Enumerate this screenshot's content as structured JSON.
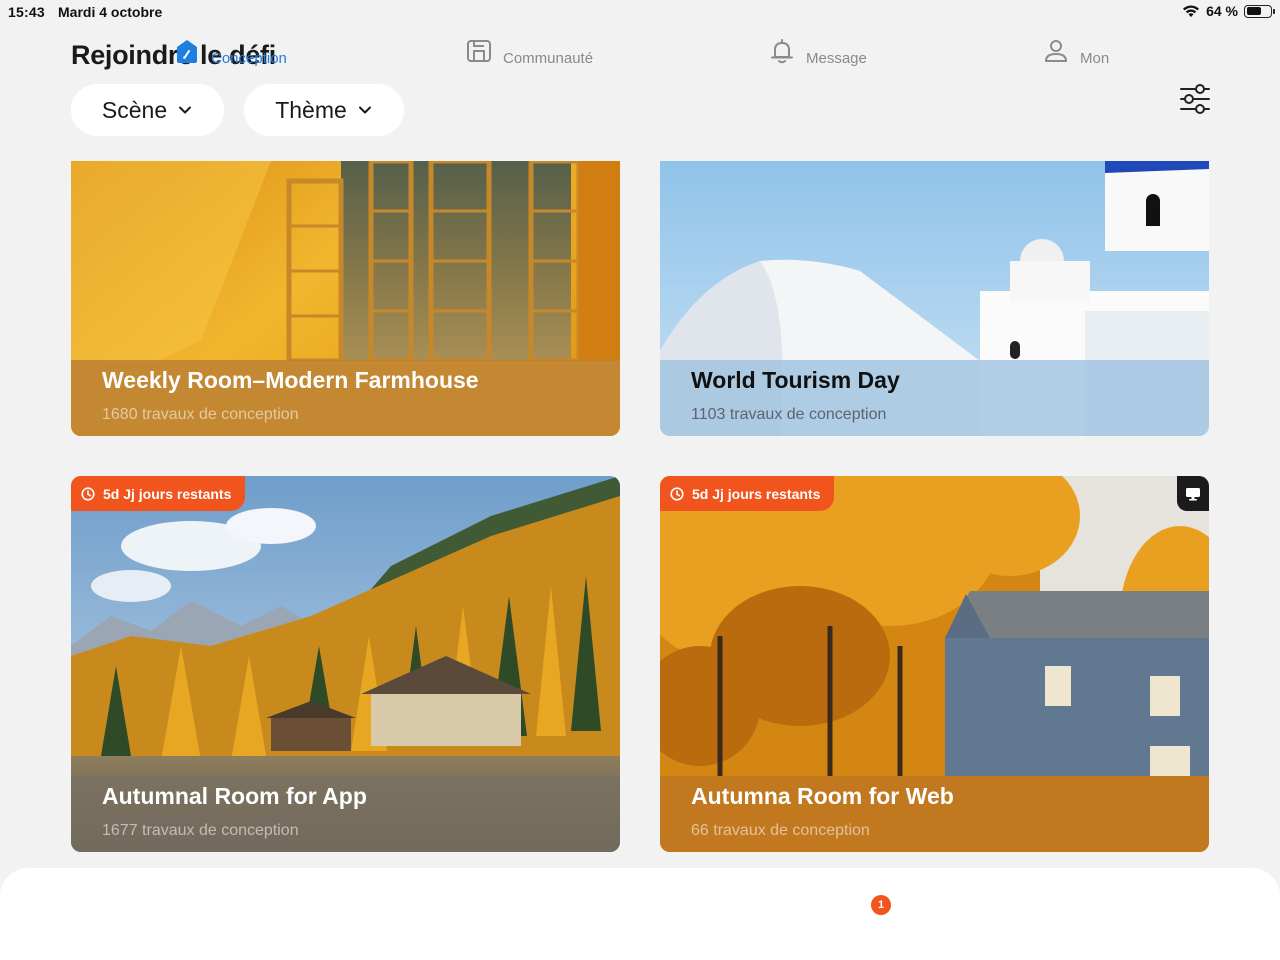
{
  "status_bar": {
    "time": "15:43",
    "date": "Mardi 4 octobre",
    "battery": "64 %",
    "battery_level": 0.64
  },
  "header": {
    "title": "Rejoindre le défi",
    "filters": [
      {
        "label": "Scène"
      },
      {
        "label": "Thème"
      }
    ]
  },
  "cards": [
    {
      "title": "Weekly Room–Modern Farmhouse",
      "subtitle": "1680 travaux de conception"
    },
    {
      "title": "World Tourism Day",
      "subtitle": "1103 travaux de conception"
    },
    {
      "title": "Autumnal Room for App",
      "subtitle": "1677 travaux de conception",
      "badge": "5d Jj jours restants"
    },
    {
      "title": "Autumna Room for Web",
      "subtitle": "66 travaux de conception",
      "badge": "5d Jj jours restants"
    }
  ],
  "tab_bar": {
    "tabs": [
      {
        "label": "Conception",
        "icon": "design-icon",
        "active": true
      },
      {
        "label": "Communauté",
        "icon": "community-icon",
        "active": false
      },
      {
        "label": "Message",
        "icon": "bell-icon",
        "active": false
      },
      {
        "label": "Mon",
        "icon": "user-icon",
        "active": false
      }
    ],
    "message_badge": "1"
  },
  "colors": {
    "accent": "#1d7fe0",
    "badge": "#f2541e",
    "background": "#f2f2f2"
  }
}
